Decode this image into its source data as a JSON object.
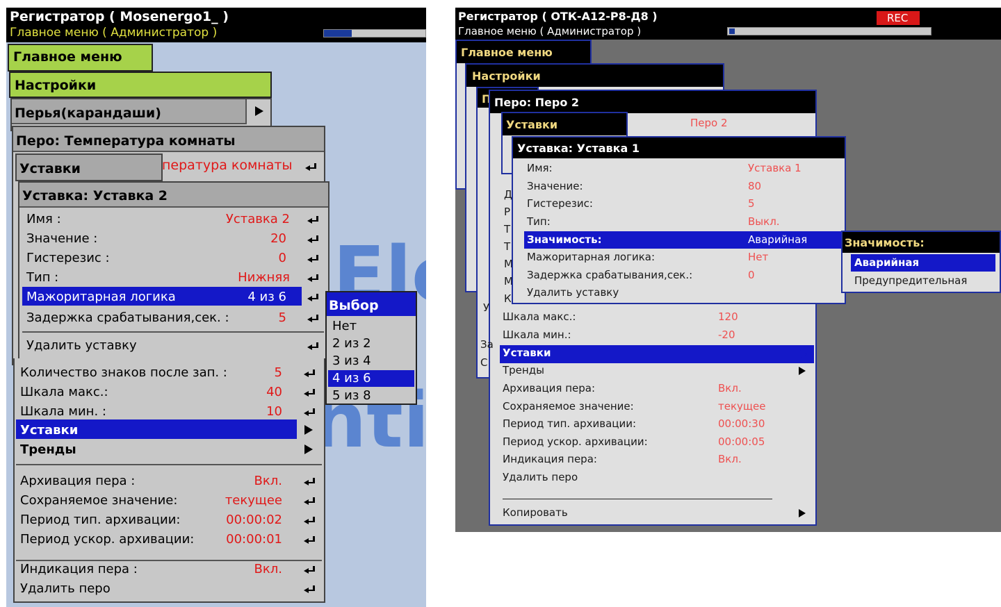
{
  "left": {
    "header": {
      "title": "Регистратор ( Mosenergo1_ )",
      "subtitle": "Главное меню ( Администратор )"
    },
    "menus": {
      "main": "Главное меню",
      "settings": "Настройки",
      "pens": "Перья(карандаши)",
      "pen": "Перо: Температура комнаты",
      "setpoints": "Уставки",
      "pen_name_partial": "пература комнаты",
      "setpoint": "Уставка: Уставка 2"
    },
    "setpoint_rows": [
      {
        "label": "Имя :",
        "value": "Уставка 2"
      },
      {
        "label": "Значение :",
        "value": "20"
      },
      {
        "label": "Гистерезис :",
        "value": "0"
      },
      {
        "label": "Тип :",
        "value": "Нижняя"
      },
      {
        "label": "Мажоритарная логика",
        "value": "4 из 6"
      },
      {
        "label": "Задержка срабатывания,сек. :",
        "value": "5"
      },
      {
        "label": "Удалить уставку",
        "value": ""
      }
    ],
    "pen_rows": [
      {
        "label": "Количество знаков после зап. :",
        "value": "5"
      },
      {
        "label": "Шкала макс.:",
        "value": "40"
      },
      {
        "label": "Шкала мин. :",
        "value": "10"
      },
      {
        "label": "Уставки",
        "value": ""
      },
      {
        "label": "Тренды",
        "value": ""
      },
      {
        "label": "Архивация пера :",
        "value": "Вкл."
      },
      {
        "label": "Сохраняемое значение:",
        "value": "текущее"
      },
      {
        "label": "Период тип. архивации:",
        "value": "00:00:02"
      },
      {
        "label": "Период ускор. архивации:",
        "value": "00:00:01"
      },
      {
        "label": "Индикация пера :",
        "value": "Вкл."
      },
      {
        "label": "Удалить перо",
        "value": ""
      }
    ],
    "popup": {
      "title": "Выбор",
      "options": [
        "Нет",
        "2 из 2",
        "3 из 4",
        "4 из 6",
        "5 из 8"
      ],
      "selected": "4 из 6"
    },
    "watermark": [
      "Ele",
      "ntis"
    ]
  },
  "right": {
    "header": {
      "title": "Регистратор ( ОТК-А12-Р8-Д8 )",
      "subtitle": "Главное меню ( Администратор )",
      "rec": "REC"
    },
    "menus": {
      "main": "Главное меню",
      "settings": "Настройки",
      "pen": "Перо: Перо 2",
      "pen_cut": "П",
      "setpoints": "Уставки",
      "pen_name": "Перо 2",
      "setpoint": "Уставка: Уставка 1"
    },
    "left_cut_letters": [
      "Д",
      "Р",
      "Т",
      "Т",
      "М",
      "М",
      "К",
      "У",
      "Зa",
      "С"
    ],
    "setpoint_rows": [
      {
        "label": "Имя:",
        "value": "Уставка 1"
      },
      {
        "label": "Значение:",
        "value": "80"
      },
      {
        "label": "Гистерезис:",
        "value": "5"
      },
      {
        "label": "Тип:",
        "value": "Выкл."
      },
      {
        "label": "Значимость:",
        "value": "Аварийная"
      },
      {
        "label": "Мажоритарная логика:",
        "value": "Нет"
      },
      {
        "label": "Задержка срабатывания,сек.:",
        "value": "0"
      },
      {
        "label": "Удалить уставку",
        "value": ""
      }
    ],
    "pen_rows": [
      {
        "label": "Шкала макс.:",
        "value": "120"
      },
      {
        "label": "Шкала мин.:",
        "value": "-20"
      },
      {
        "label": "Уставки",
        "value": ""
      },
      {
        "label": "Тренды",
        "value": ""
      },
      {
        "label": "Архивация пера:",
        "value": "Вкл."
      },
      {
        "label": "Сохраняемое значение:",
        "value": "текущее"
      },
      {
        "label": "Период тип. архивации:",
        "value": "00:00:30"
      },
      {
        "label": "Период ускор. архивации:",
        "value": "00:00:05"
      },
      {
        "label": "Индикация пера:",
        "value": "Вкл."
      },
      {
        "label": "Удалить перо",
        "value": ""
      },
      {
        "label": "Копировать",
        "value": ""
      }
    ],
    "popup": {
      "title": "Значимость:",
      "options": [
        "Аварийная",
        "Предупредительная"
      ],
      "selected": "Аварийная"
    }
  }
}
